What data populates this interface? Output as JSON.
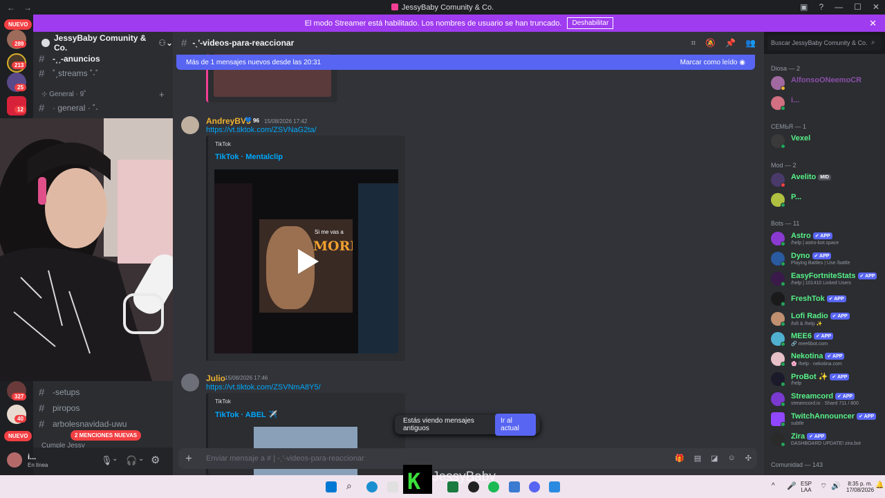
{
  "window": {
    "title": "JessyBaby Comunity & Co."
  },
  "banner": {
    "text": "El modo Streamer está habilitado. Los nombres de usuario se han truncado.",
    "button": "Deshabilitar"
  },
  "rail": {
    "new_top": "NUEVO",
    "badges": [
      "289",
      "213",
      "25",
      "12",
      "327",
      "40"
    ],
    "new_bottom": "NUEVO",
    "mentions": "2 MENCIONES NUEVAS"
  },
  "guild": {
    "name": "JessyBaby Comunity & Co."
  },
  "channels": {
    "anuncios": "-˳ˏ-anuncios",
    "streams": "˚˳streams ˚˖˚",
    "category_general": "⊹ General · 9˚",
    "general": "· general · ˚˖",
    "setups": "-setups",
    "piropos": "piropos",
    "arboles": "arbolesnavidad-uwu",
    "cumple": "Cumple Jessy"
  },
  "user": {
    "name": "i...",
    "status": "En línea"
  },
  "chat": {
    "channel": "-ˎ'-videos-para-reaccionar",
    "search_placeholder": "Buscar JessyBaby Comunity & Co.",
    "new_messages": "Más de 1 mensajes nuevos desde las 20:31",
    "mark_read": "Marcar como leído",
    "messages": [
      {
        "author": "AndreyBV5",
        "badge": "96",
        "time": "15/08/2026 17:42",
        "link": "https://vt.tiktok.com/ZSVNaG2ta/",
        "provider": "TikTok",
        "embed_title": "TikTok · Mentalclip",
        "video_text_top": "Si me vas a",
        "video_text": "MORIR"
      },
      {
        "author": "Julio",
        "time": "15/08/2026 17:46",
        "link": "https://vt.tiktok.com/ZSVNmA8Y5/",
        "provider": "TikTok",
        "embed_title": "TikTok · ABEL ✈️"
      }
    ],
    "old_notice": "Estás viendo mensajes antiguos",
    "jump_button": "Ir al actual",
    "composer_placeholder": "Enviar mensaje a # | -ˎ'-videos-para-reaccionar"
  },
  "members": {
    "groups": [
      {
        "title": "Diosa — 2",
        "members": [
          {
            "name": "AlfonsoONeemoCR",
            "color": "#8a4fa8"
          },
          {
            "name": "i...",
            "color": "#8a4fa8"
          }
        ]
      },
      {
        "title": "СЕМЬЯ — 1",
        "members": [
          {
            "name": "Vexel",
            "color": "#57f287"
          }
        ]
      },
      {
        "title": "Mod — 2",
        "members": [
          {
            "name": "Avelito",
            "tag": "MID",
            "color": "#57f287"
          },
          {
            "name": "P...",
            "color": "#57f287"
          }
        ]
      },
      {
        "title": "Bots — 11",
        "members": [
          {
            "name": "Astro",
            "status": "/help | astro-bot.space",
            "color": "#57f287"
          },
          {
            "name": "Dyno",
            "status": "Playing Battles | Use /battle",
            "color": "#57f287"
          },
          {
            "name": "EasyFortniteStats",
            "status": "/help | 101410 Linked Users",
            "color": "#57f287"
          },
          {
            "name": "FreshTok",
            "status": "",
            "color": "#57f287"
          },
          {
            "name": "Lofi Radio",
            "status": "/lofi & /help ✨",
            "color": "#57f287"
          },
          {
            "name": "MEE6",
            "status": "🔗 mee6bot.com",
            "color": "#57f287"
          },
          {
            "name": "Nekotina",
            "status": "🌸 /help · nekotina.com",
            "color": "#57f287"
          },
          {
            "name": "ProBot ✨",
            "status": "/help",
            "color": "#57f287"
          },
          {
            "name": "Streamcord",
            "status": "streamcord.io · Shard 711 / 800",
            "color": "#57f287"
          },
          {
            "name": "TwitchAnnouncer",
            "status": "subtle",
            "color": "#57f287"
          },
          {
            "name": "Zira",
            "status": "DASHBOARD UPDATE! zira.bot",
            "color": "#57f287"
          }
        ]
      },
      {
        "title": "Comunidad — 143",
        "members": []
      }
    ],
    "app_label": "✔ APP"
  },
  "overlay": {
    "brand": "JessyBaby"
  },
  "taskbar": {
    "lang": "ESP",
    "lang2": "LAA",
    "time": "8:35 p. m.",
    "date": "17/08/2026"
  }
}
